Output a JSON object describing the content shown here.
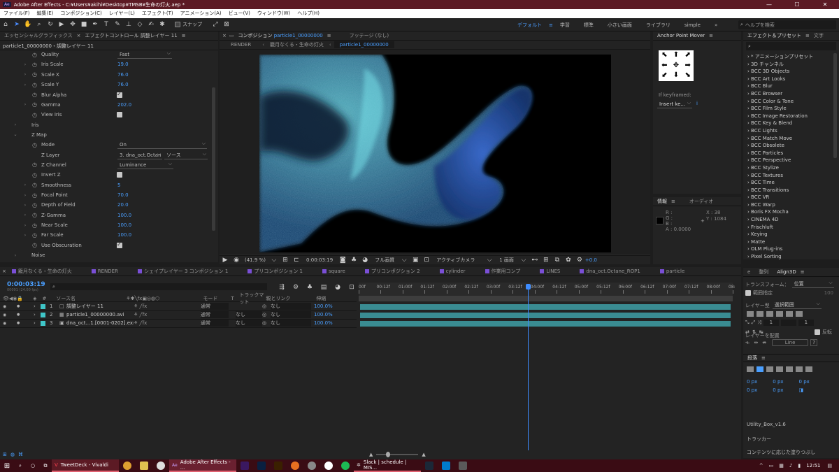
{
  "titlebar": {
    "title": "Adobe After Effects - C:¥Users¥akihi¥Desktop¥TMSB¥生命の灯火.aep *",
    "app_icon": "Ae",
    "controls": [
      "—",
      "☐",
      "✕"
    ]
  },
  "menubar": {
    "items": [
      "ファイル(F)",
      "編集(E)",
      "コンポジション(C)",
      "レイヤー(L)",
      "エフェクト(T)",
      "アニメーション(A)",
      "ビュー(V)",
      "ウィンドウ(W)",
      "ヘルプ(H)"
    ]
  },
  "toolbar": {
    "snap_label": "スナップ",
    "workspaces": [
      "デフォルト",
      "学習",
      "標準",
      "小さい画面",
      "ライブラリ",
      "simple"
    ],
    "active_workspace": "デフォルト",
    "search_placeholder": "ヘルプを検索"
  },
  "effect_controls": {
    "tabs": [
      "エッセンシャルグラフィックス",
      "エフェクトコントロール 調整レイヤー 11"
    ],
    "layer_path": "particle1_00000000・調整レイヤー 11",
    "rows": [
      {
        "indent": 1,
        "twirl": "",
        "stopwatch": true,
        "name": "Quality",
        "type": "drop",
        "value": "Fast"
      },
      {
        "indent": 1,
        "twirl": "›",
        "stopwatch": true,
        "name": "Iris Scale",
        "type": "num",
        "value": "19.0"
      },
      {
        "indent": 1,
        "twirl": "›",
        "stopwatch": true,
        "name": "Scale X",
        "type": "num",
        "value": "76.0"
      },
      {
        "indent": 1,
        "twirl": "›",
        "stopwatch": true,
        "name": "Scale Y",
        "type": "num",
        "value": "76.0"
      },
      {
        "indent": 1,
        "twirl": "",
        "stopwatch": true,
        "name": "Blur Alpha",
        "type": "check",
        "value": "on"
      },
      {
        "indent": 1,
        "twirl": "›",
        "stopwatch": true,
        "name": "Gamma",
        "type": "num",
        "value": "202.0"
      },
      {
        "indent": 1,
        "twirl": "",
        "stopwatch": true,
        "name": "View Iris",
        "type": "check",
        "value": "off"
      },
      {
        "indent": 0,
        "twirl": "›",
        "stopwatch": false,
        "name": "Iris",
        "type": "none",
        "value": ""
      },
      {
        "indent": 0,
        "twirl": "⌄",
        "stopwatch": false,
        "name": "Z Map",
        "type": "none",
        "value": ""
      },
      {
        "indent": 1,
        "twirl": "",
        "stopwatch": true,
        "name": "Mode",
        "type": "drop",
        "value": "On"
      },
      {
        "indent": 1,
        "twirl": "",
        "stopwatch": false,
        "name": "Z Layer",
        "type": "layer",
        "value": "3. dna_oct.Octan",
        "value2": "ソース"
      },
      {
        "indent": 1,
        "twirl": "",
        "stopwatch": true,
        "name": "Z Channel",
        "type": "drop",
        "value": "Luminance"
      },
      {
        "indent": 1,
        "twirl": "",
        "stopwatch": true,
        "name": "Invert Z",
        "type": "check",
        "value": "off"
      },
      {
        "indent": 1,
        "twirl": "›",
        "stopwatch": true,
        "name": "Smoothness",
        "type": "num",
        "value": "5"
      },
      {
        "indent": 1,
        "twirl": "›",
        "stopwatch": true,
        "name": "Focal Point",
        "type": "num",
        "value": "70.0"
      },
      {
        "indent": 1,
        "twirl": "›",
        "stopwatch": true,
        "name": "Depth of Field",
        "type": "num",
        "value": "20.0"
      },
      {
        "indent": 1,
        "twirl": "›",
        "stopwatch": true,
        "name": "Z-Gamma",
        "type": "num",
        "value": "100.0"
      },
      {
        "indent": 1,
        "twirl": "›",
        "stopwatch": true,
        "name": "Near Scale",
        "type": "num",
        "value": "100.0"
      },
      {
        "indent": 1,
        "twirl": "›",
        "stopwatch": true,
        "name": "Far Scale",
        "type": "num",
        "value": "100.0"
      },
      {
        "indent": 1,
        "twirl": "",
        "stopwatch": true,
        "name": "Use Obscuration",
        "type": "check",
        "value": "on"
      },
      {
        "indent": 0,
        "twirl": "›",
        "stopwatch": false,
        "name": "Noise",
        "type": "none",
        "value": ""
      }
    ]
  },
  "composition": {
    "tab_label": "コンポジション",
    "comp_name": "particle1_00000000",
    "footage_tab": "フッテージ (なし)",
    "breadcrumbs": [
      "RENDER",
      "籠月なくる・生命の灯火",
      "particle1_00000000"
    ],
    "zoom": "(41.9 %)",
    "timecode": "0:00:03:19",
    "resolution": "フル画質",
    "camera": "アクティブカメラ",
    "views": "1 画面",
    "exposure": "+0.0"
  },
  "anchor_point": {
    "title": "Anchor Point Mover",
    "keyframed_label": "If keyframed:",
    "keyframed_value": "Insert ke..."
  },
  "info_panel": {
    "tabs": [
      "情報",
      "オーディオ"
    ],
    "r": "R :",
    "g": "G :",
    "b": "B :",
    "a": "A :",
    "a_value": "0.0000",
    "x": "X : 38",
    "y": "Y : 1084"
  },
  "effects_presets": {
    "tabs": [
      "エフェクト＆プリセット",
      "文字"
    ],
    "search_placeholder": "",
    "items": [
      "* アニメーションプリセット",
      "3D チャンネル",
      "BCC 3D Objects",
      "BCC Art Looks",
      "BCC Blur",
      "BCC Browser",
      "BCC Color & Tone",
      "BCC Film Style",
      "BCC Image Restoration",
      "BCC Key & Blend",
      "BCC Lights",
      "BCC Match Move",
      "BCC Obsolete",
      "BCC Particles",
      "BCC Perspective",
      "BCC Stylize",
      "BCC Textures",
      "BCC Time",
      "BCC Transitions",
      "BCC VR",
      "BCC Warp",
      "Boris FX Mocha",
      "CINEMA 4D",
      "Frischluft",
      "Keying",
      "Matte",
      "OLM Plug-ins",
      "Pixel Sorting"
    ]
  },
  "align_panel": {
    "tabs": [
      "e",
      "整列",
      "Align3D"
    ],
    "transform_label": "トランスフォーム：",
    "transform_value": "位置",
    "range_label": "範囲指定",
    "range_value": "100",
    "layer_type_label": "レイヤー型",
    "layer_type_value": "選択範囲",
    "inputs": [
      "1",
      "",
      "1"
    ],
    "flip_label": "反転",
    "distribute_label": "レイヤーを配置",
    "line_label": "Line",
    "paragraph_tab": "段落",
    "px_values": [
      "0 px",
      "0 px",
      "0 px",
      "0 px",
      "0 px"
    ],
    "utility": "Utility_Box_v1.6",
    "tracker": "トラッカー",
    "content_fill": "コンテンツに応じた塗りつぶし"
  },
  "timeline": {
    "tabs": [
      {
        "label": "籠月なくる・生命の灯火",
        "color": "#7a4fd6"
      },
      {
        "label": "RENDER",
        "color": "#7a4fd6"
      },
      {
        "label": "シェイプレイヤー 3 コンポジション 1",
        "color": "#7a4fd6"
      },
      {
        "label": "プリコンポジション 1",
        "color": "#7a4fd6"
      },
      {
        "label": "square",
        "color": "#7a4fd6"
      },
      {
        "label": "プリコンポジション 2",
        "color": "#7a4fd6"
      },
      {
        "label": "cylinder",
        "color": "#7a4fd6"
      },
      {
        "label": "作業用コンプ",
        "color": "#7a4fd6"
      },
      {
        "label": "LINES",
        "color": "#7a4fd6"
      },
      {
        "label": "dna_oct.Octane_ROP1",
        "color": "#7a4fd6"
      },
      {
        "label": "particle",
        "color": "#7a4fd6"
      }
    ],
    "current_time": "0:00:03:19",
    "frame_info": "00091 (24.00 fps)",
    "col_source": "ソース名",
    "col_mode": "モード",
    "col_t": "T",
    "col_trackmatte": "トラックマット",
    "col_parent": "親とリンク",
    "col_stretch": "伸縮",
    "ruler": [
      "00f",
      "00:12f",
      "01:00f",
      "01:12f",
      "02:00f",
      "02:12f",
      "03:00f",
      "03:12f",
      "04:00f",
      "04:12f",
      "05:00f",
      "05:12f",
      "06:00f",
      "06:12f",
      "07:00f",
      "07:12f",
      "08:00f",
      "08:"
    ],
    "playhead_fraction": 0.452,
    "layers": [
      {
        "num": "1",
        "name": "調整レイヤー 11",
        "label_color": "#3fc6c8",
        "mode": "通常",
        "trackmatte": "",
        "parent": "なし",
        "stretch": "100.0%",
        "icon": "□"
      },
      {
        "num": "2",
        "name": "particle1_00000000.avi",
        "label_color": "#3fc6c8",
        "mode": "通常",
        "trackmatte": "なし",
        "parent": "なし",
        "stretch": "100.0%",
        "icon": "▦"
      },
      {
        "num": "3",
        "name": "dna_oct...1.[0001-0202].exr",
        "label_color": "#3fc6c8",
        "mode": "通常",
        "trackmatte": "なし",
        "parent": "なし",
        "stretch": "100.0%",
        "icon": "▣"
      }
    ]
  },
  "taskbar": {
    "items": [
      "TweetDeck - Vivaldi",
      "Adobe After Effects - ...",
      "Slack | schedule | MIS..."
    ],
    "clock": "12:51"
  }
}
